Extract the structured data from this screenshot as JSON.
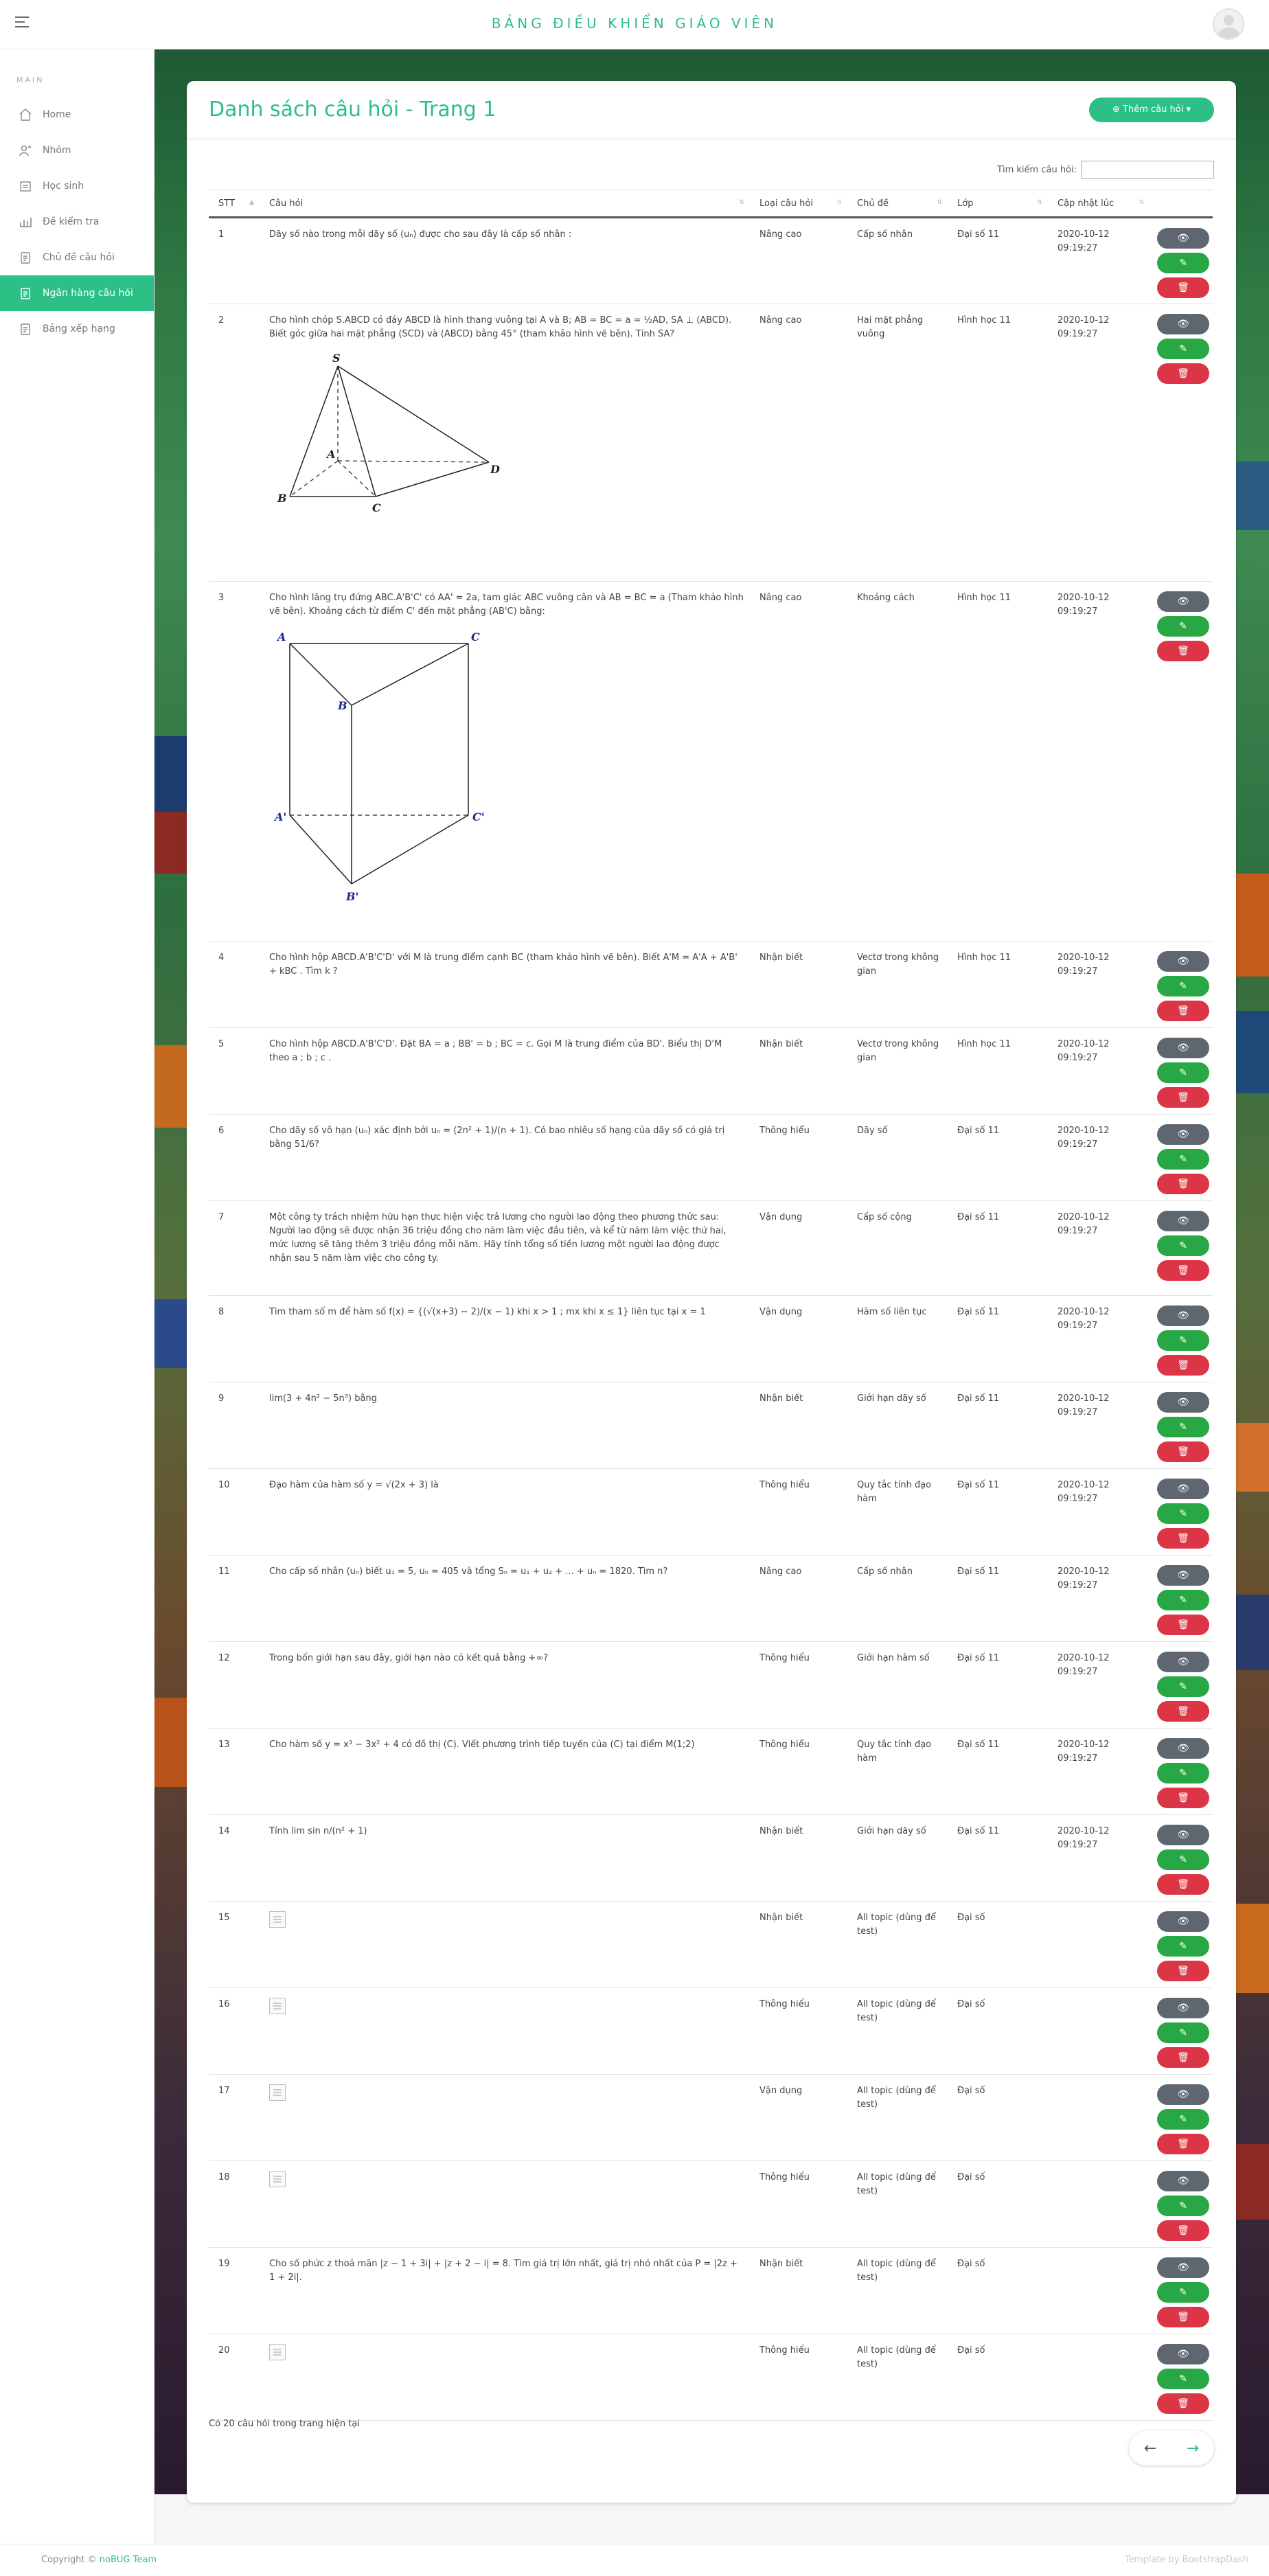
{
  "header": {
    "title": "BẢNG ĐIỀU KHIỂN GIÁO VIÊN"
  },
  "sidebar": {
    "section": "MAIN",
    "items": [
      {
        "label": "Home",
        "icon": "home-icon"
      },
      {
        "label": "Nhóm",
        "icon": "group-icon"
      },
      {
        "label": "Học sinh",
        "icon": "student-icon"
      },
      {
        "label": "Đề kiểm tra",
        "icon": "chart-icon"
      },
      {
        "label": "Chủ đề câu hỏi",
        "icon": "clipboard-icon"
      },
      {
        "label": "Ngân hàng câu hỏi",
        "icon": "clipboard-icon",
        "active": true
      },
      {
        "label": "Bảng xếp hạng",
        "icon": "clipboard-icon"
      }
    ]
  },
  "page": {
    "title": "Danh sách câu hỏi - Trang 1",
    "add_button": "Thêm câu hỏi",
    "search_label": "Tìm kiếm câu hỏi:",
    "summary": "Có 20 câu hỏi trong trang hiện tại",
    "pager": {
      "prev": "←",
      "next": "→"
    }
  },
  "table": {
    "columns": [
      "STT",
      "Câu hỏi",
      "Loại câu hỏi",
      "Chủ đề",
      "Lớp",
      "Cập nhật lúc",
      ""
    ],
    "rows": [
      {
        "stt": "1",
        "question": "Dãy số nào trong mỗi dãy số (uₙ) được cho sau đây là cấp số nhân :",
        "type": "Nâng cao",
        "topic": "Cấp số nhân",
        "grade": "Đại số 11",
        "updated": "2020-10-12 09:19:27"
      },
      {
        "stt": "2",
        "question": "Cho hình chóp S.ABCD có đáy ABCD là hình thang vuông tại A và B; AB = BC = a = ½AD, SA ⊥ (ABCD). Biết góc giữa hai mặt phẳng (SCD) và (ABCD) bằng 45° (tham khảo hình vẽ bên). Tính SA?",
        "type": "Nâng cao",
        "topic": "Hai mặt phẳng vuông",
        "grade": "Hình học 11",
        "updated": "2020-10-12 09:19:27"
      },
      {
        "stt": "3",
        "question": "Cho hình lăng trụ đứng ABC.A'B'C' có AA' = 2a, tam giác ABC vuông cân và AB = BC = a (Tham khảo hình vẽ bên). Khoảng cách từ điểm C' đến mặt phẳng (AB'C) bằng:",
        "type": "Nâng cao",
        "topic": "Khoảng cách",
        "grade": "Hình học 11",
        "updated": "2020-10-12 09:19:27"
      },
      {
        "stt": "4",
        "question": "Cho hình hộp ABCD.A'B'C'D' với M là trung điểm cạnh BC (tham khảo hình vẽ bên). Biết A'M = A'A + A'B' + kBC . Tìm k ?",
        "type": "Nhận biết",
        "topic": "Vectơ trong không gian",
        "grade": "Hình học 11",
        "updated": "2020-10-12 09:19:27"
      },
      {
        "stt": "5",
        "question": "Cho hình hộp ABCD.A'B'C'D'. Đặt BA = a ; BB' = b ; BC = c. Gọi M là trung điểm của BD'. Biểu thị D'M theo a ; b ; c .",
        "type": "Nhận biết",
        "topic": "Vectơ trong không gian",
        "grade": "Hình học 11",
        "updated": "2020-10-12 09:19:27"
      },
      {
        "stt": "6",
        "question": "Cho dãy số vô hạn (uₙ) xác định bởi uₙ = (2n² + 1)/(n + 1). Có bao nhiêu số hạng của dãy số có giá trị bằng 51/6?",
        "type": "Thông hiểu",
        "topic": "Dãy số",
        "grade": "Đại số 11",
        "updated": "2020-10-12 09:19:27"
      },
      {
        "stt": "7",
        "question": "Một công ty trách nhiệm hữu hạn thực hiện việc trả lương cho người lao động theo phương thức sau: Người lao động sẽ được nhận 36 triệu đồng cho năm làm việc đầu tiên, và kể từ năm làm việc thứ hai, mức lương sẽ tăng thêm 3 triệu đồng mỗi năm. Hãy tính tổng số tiền lương một người lao động được nhận sau 5 năm làm việc cho công ty.",
        "type": "Vận dụng",
        "topic": "Cấp số cộng",
        "grade": "Đại số 11",
        "updated": "2020-10-12 09:19:27"
      },
      {
        "stt": "8",
        "question": "Tìm tham số m để hàm số f(x) = {(√(x+3) − 2)/(x − 1) khi x > 1 ; mx khi x ≤ 1} liên tục tại x = 1",
        "type": "Vận dụng",
        "topic": "Hàm số liên tục",
        "grade": "Đại số 11",
        "updated": "2020-10-12 09:19:27"
      },
      {
        "stt": "9",
        "question": "lim(3 + 4n² − 5n³) bằng",
        "type": "Nhận biết",
        "topic": "Giới hạn dãy số",
        "grade": "Đại số 11",
        "updated": "2020-10-12 09:19:27"
      },
      {
        "stt": "10",
        "question": "Đạo hàm của hàm số y = √(2x + 3) là",
        "type": "Thông hiểu",
        "topic": "Quy tắc tính đạo hàm",
        "grade": "Đại số 11",
        "updated": "2020-10-12 09:19:27"
      },
      {
        "stt": "11",
        "question": "Cho cấp số nhân (uₙ) biết u₁ = 5, uₙ = 405 và tổng Sₙ = u₁ + u₂ + ... + uₙ = 1820. Tìm n?",
        "type": "Nâng cao",
        "topic": "Cấp số nhân",
        "grade": "Đại số 11",
        "updated": "2020-10-12 09:19:27"
      },
      {
        "stt": "12",
        "question": "Trong bốn giới hạn sau đây, giới hạn nào có kết quả bằng +∞?",
        "type": "Thông hiểu",
        "topic": "Giới hạn hàm số",
        "grade": "Đại số 11",
        "updated": "2020-10-12 09:19:27"
      },
      {
        "stt": "13",
        "question": "Cho hàm số y = x³ − 3x² + 4 có đồ thị (C). Viết phương trình tiếp tuyến của (C) tại điểm M(1;2)",
        "type": "Thông hiểu",
        "topic": "Quy tắc tính đạo hàm",
        "grade": "Đại số 11",
        "updated": "2020-10-12 09:19:27"
      },
      {
        "stt": "14",
        "question": "Tính lim sin n/(n² + 1)",
        "type": "Nhận biết",
        "topic": "Giới hạn dãy số",
        "grade": "Đại số 11",
        "updated": "2020-10-12 09:19:27"
      },
      {
        "stt": "15",
        "question": "",
        "image": true,
        "type": "Nhận biết",
        "topic": "All topic (dùng để test)",
        "grade": "Đại số",
        "updated": ""
      },
      {
        "stt": "16",
        "question": "",
        "image": true,
        "type": "Thông hiểu",
        "topic": "All topic (dùng để test)",
        "grade": "Đại số",
        "updated": ""
      },
      {
        "stt": "17",
        "question": "",
        "image": true,
        "type": "Vận dụng",
        "topic": "All topic (dùng để test)",
        "grade": "Đại số",
        "updated": ""
      },
      {
        "stt": "18",
        "question": "",
        "image": true,
        "type": "Thông hiểu",
        "topic": "All topic (dùng để test)",
        "grade": "Đại số",
        "updated": ""
      },
      {
        "stt": "19",
        "question": "Cho số phức z thoả mãn |z − 1 + 3i| + |z + 2 − i| = 8. Tìm giá trị lớn nhất, giá trị nhỏ nhất của P = |2z + 1 + 2i|.",
        "type": "Nhận biết",
        "topic": "All topic (dùng để test)",
        "grade": "Đại số",
        "updated": ""
      },
      {
        "stt": "20",
        "question": "",
        "image": true,
        "type": "Thông hiểu",
        "topic": "All topic (dùng để test)",
        "grade": "Đại số",
        "updated": ""
      }
    ]
  },
  "footer": {
    "copyright_prefix": "Copyright ©",
    "team": "noBUG Team",
    "template": "Template by BootstrapDash"
  },
  "colors": {
    "accent": "#2cbf86",
    "view": "#5e6670",
    "edit": "#28a745",
    "delete": "#dc3545"
  }
}
